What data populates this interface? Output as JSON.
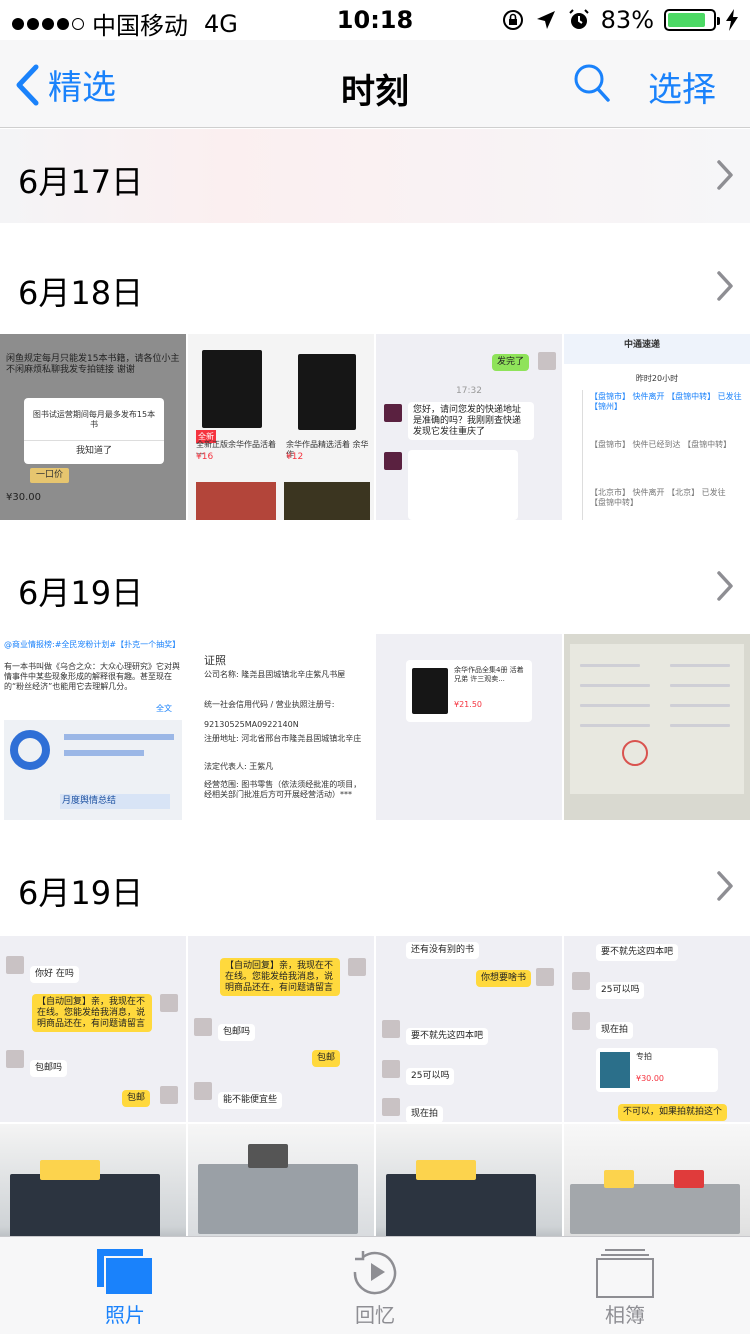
{
  "status": {
    "carrier": "中国移动",
    "network": "4G",
    "time": "10:18",
    "battery": "83%",
    "battery_level": 0.83,
    "battery_color": "#4cd964"
  },
  "nav": {
    "back_label": "精选",
    "title": "时刻",
    "select_label": "选择",
    "accent_color": "#1a82fb"
  },
  "sections": [
    {
      "date": "6月17日"
    },
    {
      "date": "6月18日"
    },
    {
      "date": "6月19日"
    },
    {
      "date": "6月19日"
    }
  ],
  "thumbs": {
    "r1t1": {
      "dialog_text": "图书试运营期间每月最多发布15本书",
      "dialog_button": "我知道了",
      "price": "¥30.00",
      "top_text": "闲鱼规定每月只能发15本书籍，请各位小主不闲麻烦私聊我发专拍链接 谢谢",
      "button": "一口价"
    },
    "r1t2": {
      "tag": "全新",
      "title1": "全新正版余华作品活着一",
      "price1": "¥16",
      "title2": "余华作品精选活着 余华作",
      "price2": "¥12"
    },
    "r1t3": {
      "me1": "发完了",
      "time": "17:32",
      "other1": "您好，请问您发的快递地址是准确的吗？我刚刚查快递发现它发往重庆了"
    },
    "r1t4": {
      "company": "中通速递",
      "status1": "昨时20小时",
      "l1": "【盘锦市】 快件离开 【盘锦中转】 已发往 【锦州】",
      "l2": "【盘锦市】 快件已经到达 【盘锦中转】",
      "l3": "【北京市】 快件离开 【北京】 已发往 【盘锦中转】"
    },
    "r2t1": {
      "headline": "@商业情报榜:#全民宠粉计划#【扑克一个抽奖】",
      "body": "有一本书叫做《乌合之众：大众心理研究》它对舆情事件中某些现象形成的解释很有趣。甚至现在的“粉丝经济”也能用它去理解几分。",
      "more": "全文",
      "report": "月度舆情总结"
    },
    "r2t2": {
      "heading": "证照",
      "company": "公司名称: 隆尧县固城镇北辛庄紫凡书屋",
      "credit_label": "统一社会信用代码 / 营业执照注册号:",
      "credit": "92130525MA0922140N",
      "address": "注册地址: 河北省邢台市隆尧县固城镇北辛庄",
      "legal": "法定代表人: 王紫凡",
      "scope": "经营范围: 图书零售（依法须经批准的项目，经相关部门批准后方可开展经营活动）***"
    },
    "r2t3": {
      "text": "余华作品全集4册 活着 兄弟 许三观卖...",
      "price": "¥21.50"
    },
    "r3t1": {
      "b1": "你好 在吗",
      "b2": "【自动回复】亲，我现在不在线。您能发给我消息，说明商品还在，有问题请留言",
      "b3": "包邮吗",
      "b4": "包邮"
    },
    "r3t2": {
      "b1": "【自动回复】亲，我现在不在线。您能发给我消息，说明商品还在，有问题请留言",
      "b2": "包邮吗",
      "b3": "包邮",
      "b4": "能不能便宜些"
    },
    "r3t3": {
      "b1": "还有没有别的书",
      "b2": "你想要啥书",
      "b3": "要不就先这四本吧",
      "b4": "25可以吗",
      "b5": "现在拍"
    },
    "r3t4": {
      "b1": "要不就先这四本吧",
      "b2": "25可以吗",
      "b3": "现在拍",
      "card_title": "专拍",
      "card_price": "¥30.00",
      "b4": "不可以，如果拍就拍这个"
    }
  },
  "tabs": [
    {
      "label": "照片",
      "active": true
    },
    {
      "label": "回忆",
      "active": false
    },
    {
      "label": "相簿",
      "active": false
    }
  ]
}
